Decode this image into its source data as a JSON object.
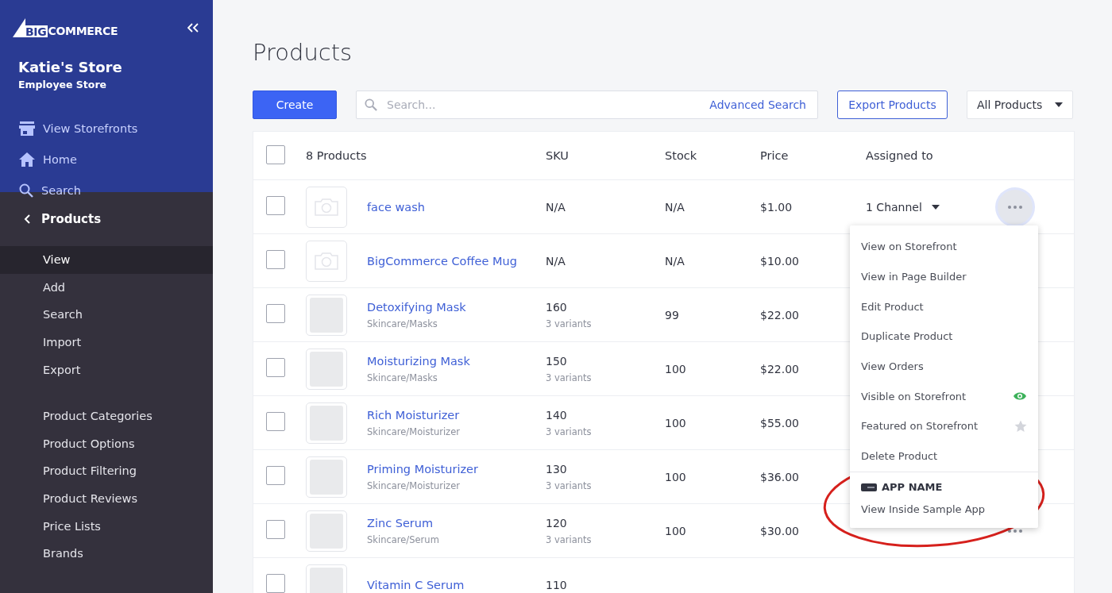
{
  "sidebar": {
    "logo_mark": "BIG",
    "logo_word": "COMMERCE",
    "store_name": "Katie's Store",
    "store_subtitle": "Employee Store",
    "top_items": [
      {
        "label": "View Storefronts",
        "kind": "storefront"
      },
      {
        "label": "Home",
        "kind": "home"
      },
      {
        "label": "Search",
        "kind": "search"
      }
    ],
    "section": {
      "label": "Products",
      "expanded": true
    },
    "item_groups": [
      [
        {
          "label": "View",
          "selected": true
        },
        {
          "label": "Add",
          "selected": false
        },
        {
          "label": "Search",
          "selected": false
        },
        {
          "label": "Import",
          "selected": false
        },
        {
          "label": "Export",
          "selected": false
        }
      ],
      [
        {
          "label": "Product Categories",
          "selected": false
        },
        {
          "label": "Product Options",
          "selected": false
        },
        {
          "label": "Product Filtering",
          "selected": false
        },
        {
          "label": "Product Reviews",
          "selected": false
        },
        {
          "label": "Price Lists",
          "selected": false
        },
        {
          "label": "Brands",
          "selected": false
        }
      ]
    ]
  },
  "page_title": "Products",
  "toolbar": {
    "create_button": "Create",
    "search": {
      "placeholder": "Search...",
      "advanced_link": "Advanced Search"
    },
    "export_button": "Export Products",
    "filter": {
      "value": "All Products"
    }
  },
  "table": {
    "select_all": {
      "checked": false
    },
    "columns": [
      "8 Products",
      "SKU",
      "Stock",
      "Price",
      "Assigned to"
    ],
    "rows": [
      {
        "name": "face wash",
        "kind": "placeholder",
        "sku": "N/A",
        "stock": "N/A",
        "price": "$1.00",
        "channel": "1 Channel",
        "menu_open": true,
        "checked": false
      },
      {
        "name": "BigCommerce Coffee Mug",
        "kind": "placeholder",
        "sku": "N/A",
        "stock": "N/A",
        "price": "$10.00",
        "checked": false
      },
      {
        "name": "Detoxifying Mask",
        "category": "Skincare/Masks",
        "kind": "photo",
        "sku": "160",
        "variants": "3 variants",
        "stock": "99",
        "price": "$22.00",
        "checked": false
      },
      {
        "name": "Moisturizing Mask",
        "category": "Skincare/Masks",
        "kind": "photo",
        "sku": "150",
        "variants": "3 variants",
        "stock": "100",
        "price": "$22.00",
        "checked": false
      },
      {
        "name": "Rich Moisturizer",
        "category": "Skincare/Moisturizer",
        "kind": "photo",
        "sku": "140",
        "variants": "3 variants",
        "stock": "100",
        "price": "$55.00",
        "checked": false
      },
      {
        "name": "Priming Moisturizer",
        "category": "Skincare/Moisturizer",
        "kind": "photo",
        "sku": "130",
        "variants": "3 variants",
        "stock": "100",
        "price": "$36.00",
        "checked": false
      },
      {
        "name": "Zinc Serum",
        "category": "Skincare/Serum",
        "kind": "photo",
        "sku": "120",
        "variants": "3 variants",
        "stock": "100",
        "price": "$30.00",
        "menu_open": false,
        "checked": false
      },
      {
        "name": "Vitamin C Serum",
        "kind": "photo",
        "sku": "110",
        "checked": false
      }
    ]
  },
  "row_menu": {
    "items": [
      {
        "label": "View on Storefront",
        "kind": "action"
      },
      {
        "label": "View in Page Builder",
        "kind": "action"
      },
      {
        "label": "Edit Product",
        "kind": "action"
      },
      {
        "label": "Duplicate Product",
        "kind": "action"
      },
      {
        "label": "View Orders",
        "kind": "action"
      },
      {
        "label": "Visible on Storefront",
        "kind": "visibility",
        "on": true
      },
      {
        "label": "Featured on Storefront",
        "kind": "featured",
        "on": false
      },
      {
        "label": "Delete Product",
        "kind": "action"
      }
    ],
    "app_section": {
      "title": "APP NAME",
      "items": [
        "View Inside Sample App"
      ]
    }
  }
}
